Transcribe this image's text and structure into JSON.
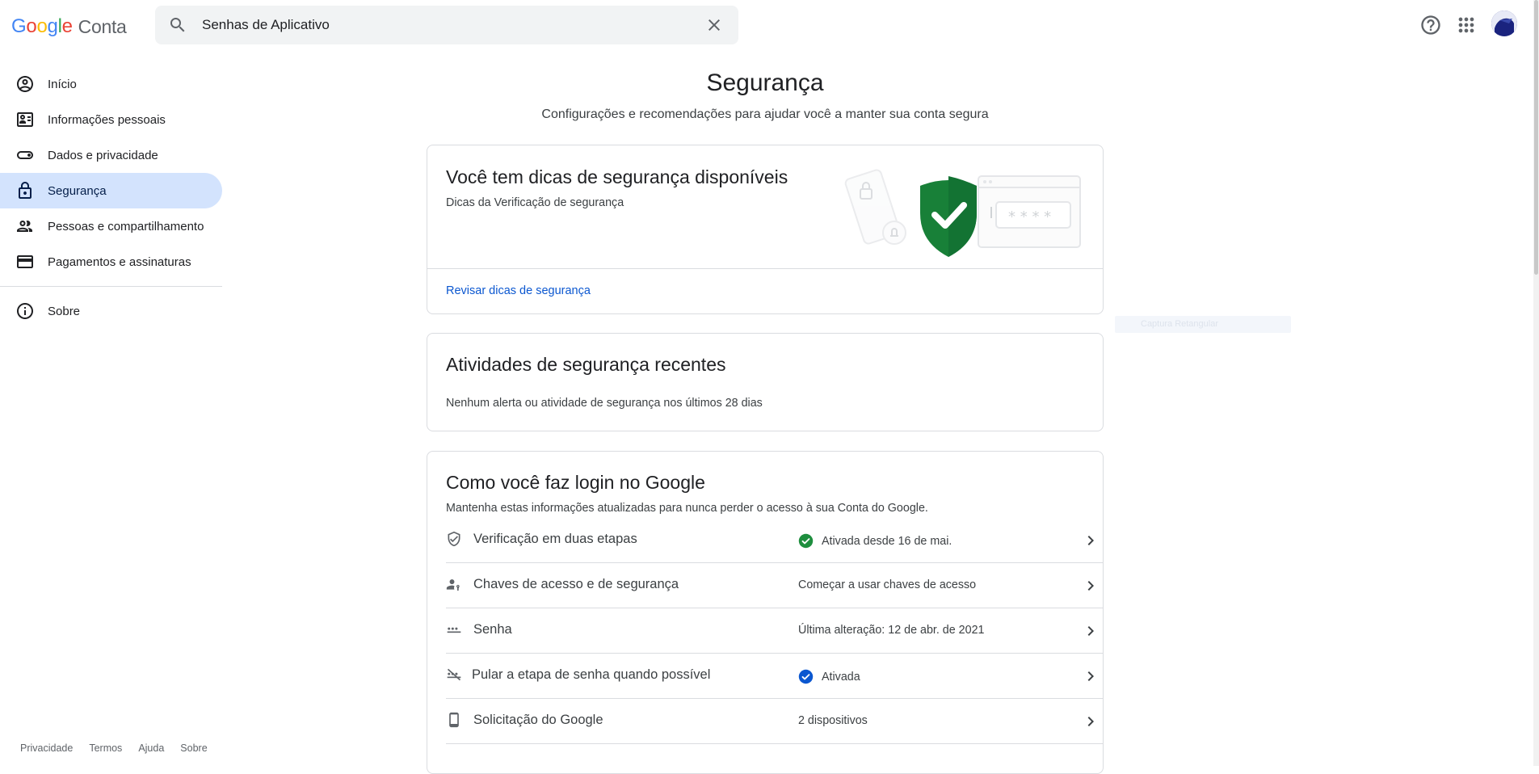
{
  "header": {
    "logo_g1": "G",
    "logo_g2": "o",
    "logo_g3": "o",
    "logo_g4": "g",
    "logo_g5": "l",
    "logo_g6": "e",
    "logo_product": "Conta",
    "search_value": "Senhas de Aplicativo"
  },
  "sidebar": {
    "items": [
      {
        "label": "Início"
      },
      {
        "label": "Informações pessoais"
      },
      {
        "label": "Dados e privacidade"
      },
      {
        "label": "Segurança"
      },
      {
        "label": "Pessoas e compartilhamento"
      },
      {
        "label": "Pagamentos e assinaturas"
      }
    ],
    "about": "Sobre"
  },
  "footer": {
    "privacy": "Privacidade",
    "terms": "Termos",
    "help": "Ajuda",
    "about": "Sobre"
  },
  "main": {
    "title": "Segurança",
    "subtitle": "Configurações e recomendações para ajudar você a manter sua conta segura"
  },
  "tips_card": {
    "title": "Você tem dicas de segurança disponíveis",
    "subtitle": "Dicas da Verificação de segurança",
    "link": "Revisar dicas de segurança"
  },
  "activity_card": {
    "title": "Atividades de segurança recentes",
    "text": "Nenhum alerta ou atividade de segurança nos últimos 28 dias"
  },
  "login_card": {
    "title": "Como você faz login no Google",
    "subtitle": "Mantenha estas informações atualizadas para nunca perder o acesso à sua Conta do Google.",
    "rows": [
      {
        "label": "Verificação em duas etapas",
        "status": "Ativada desde 16 de mai."
      },
      {
        "label": "Chaves de acesso e de segurança",
        "status": "Começar a usar chaves de acesso"
      },
      {
        "label": "Senha",
        "status": "Última alteração: 12 de abr. de 2021"
      },
      {
        "label": "Pular a etapa de senha quando possível",
        "status": "Ativada"
      },
      {
        "label": "Solicitação do Google",
        "status": "2 dispositivos"
      }
    ]
  },
  "ghost_label": "Captura Retangular",
  "colors": {
    "accent_blue": "#0b57d0",
    "active_nav": "#d3e3fd",
    "check_green": "#1e8e3e",
    "shield_green": "#188038"
  }
}
